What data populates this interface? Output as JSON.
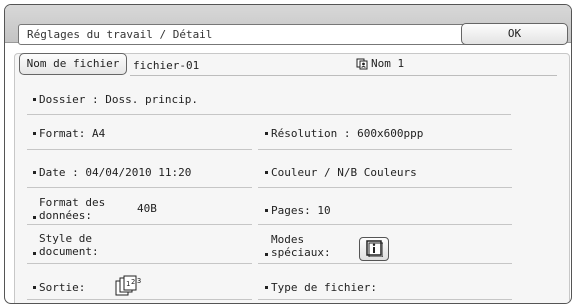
{
  "window": {
    "title": "Réglages du travail / Détail"
  },
  "buttons": {
    "ok_label": "OK",
    "filename_label": "Nom de fichier"
  },
  "file": {
    "name": "fichier-01",
    "user": "Nom 1"
  },
  "details": {
    "folder": "Dossier : Doss. princip.",
    "format": "Format: A4",
    "resolution": "Résolution : 600x600ppp",
    "date": "Date : 04/04/2010 11:20",
    "color": "Couleur / N/B Couleurs",
    "data_format_label_1": "Format des",
    "data_format_label_2": "données:",
    "data_format_value": "40B",
    "pages": "Pages: 10",
    "doc_style_label_1": "Style de",
    "doc_style_label_2": "document:",
    "special_modes_label_1": "Modes",
    "special_modes_label_2": "spéciaux:",
    "output": "Sortie:",
    "file_type": "Type de fichier:"
  },
  "icons": {
    "user": "user-copy-icon",
    "special_modes": "info-icon",
    "output": "sorted-pages-icon"
  }
}
